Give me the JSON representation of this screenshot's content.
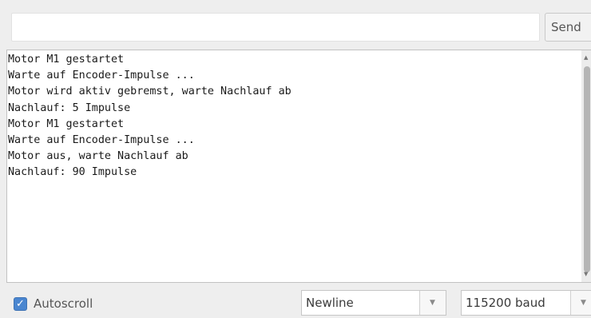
{
  "input": {
    "value": "",
    "send_label": "Send"
  },
  "output": {
    "lines": [
      "Motor M1 gestartet",
      "Warte auf Encoder-Impulse ...",
      "Motor wird aktiv gebremst, warte Nachlauf ab",
      "Nachlauf: 5 Impulse",
      "Motor M1 gestartet",
      "Warte auf Encoder-Impulse ...",
      "Motor aus, warte Nachlauf ab",
      "Nachlauf: 90 Impulse"
    ]
  },
  "footer": {
    "autoscroll_label": "Autoscroll",
    "autoscroll_checked": true,
    "line_ending": "Newline",
    "baud_rate": "115200 baud"
  },
  "icons": {
    "check": "check-icon",
    "dropdown": "chevron-down-icon",
    "scroll_up": "arrow-up-icon",
    "scroll_down": "arrow-down-icon"
  },
  "colors": {
    "checkbox_accent": "#4a86d0"
  }
}
